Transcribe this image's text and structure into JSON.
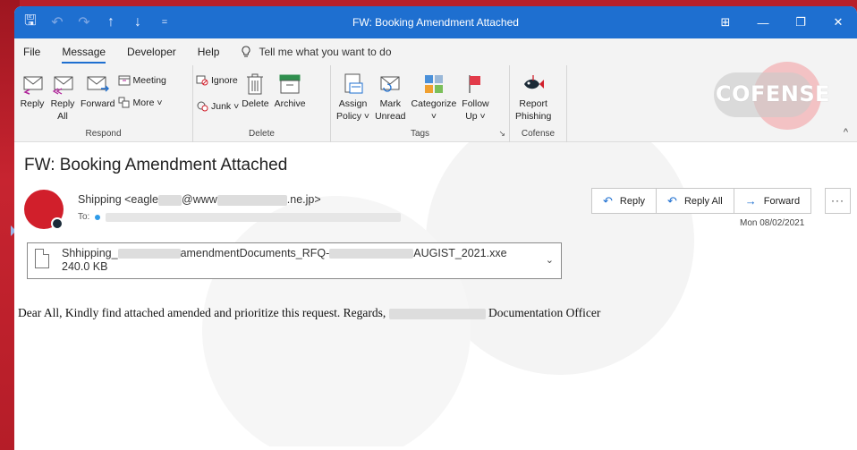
{
  "window": {
    "title": "FW: Booking Amendment Attached",
    "controls": [
      "⊞",
      "—",
      "❐",
      "✕"
    ]
  },
  "menu": {
    "items": [
      "File",
      "Message",
      "Developer",
      "Help"
    ],
    "active": "Message",
    "tell_me": "Tell me what you want to do"
  },
  "ribbon": {
    "respond": {
      "label": "Respond",
      "reply": "Reply",
      "reply_all_1": "Reply",
      "reply_all_2": "All",
      "forward": "Forward",
      "meeting": "Meeting",
      "more": "More ˅"
    },
    "delete": {
      "label": "Delete",
      "ignore": "Ignore",
      "junk": "Junk ˅",
      "delete": "Delete",
      "archive": "Archive"
    },
    "tags": {
      "label": "Tags",
      "assign_1": "Assign",
      "assign_2": "Policy ˅",
      "mark_1": "Mark",
      "mark_2": "Unread",
      "categorize_1": "Categorize",
      "categorize_2": "˅",
      "follow_1": "Follow",
      "follow_2": "Up ˅"
    },
    "cofense": {
      "label": "Cofense",
      "report_1": "Report",
      "report_2": "Phishing",
      "logo_text": "COFENSE"
    }
  },
  "message": {
    "subject": "FW: Booking Amendment Attached",
    "sender_prefix": "Shipping <eagle",
    "sender_mid": "@www",
    "sender_suffix": ".ne.jp>",
    "to_label": "To:",
    "date": "Mon 08/02/2021",
    "actions": {
      "reply": "Reply",
      "reply_all": "Reply All",
      "forward": "Forward",
      "more": "···"
    },
    "attachment": {
      "name_part1": "Shhipping_",
      "name_part2": "amendmentDocuments_RFQ-",
      "name_part3": "AUGIST_2021.xxe",
      "size": "240.0 KB"
    },
    "body_part1": "Dear All, Kindly find attached amended and prioritize this request. Regards,",
    "body_part2": "Documentation Officer"
  },
  "colors": {
    "titlebar": "#1e6fd0",
    "background_red": "#b8202a",
    "avatar": "#d11f2b"
  }
}
